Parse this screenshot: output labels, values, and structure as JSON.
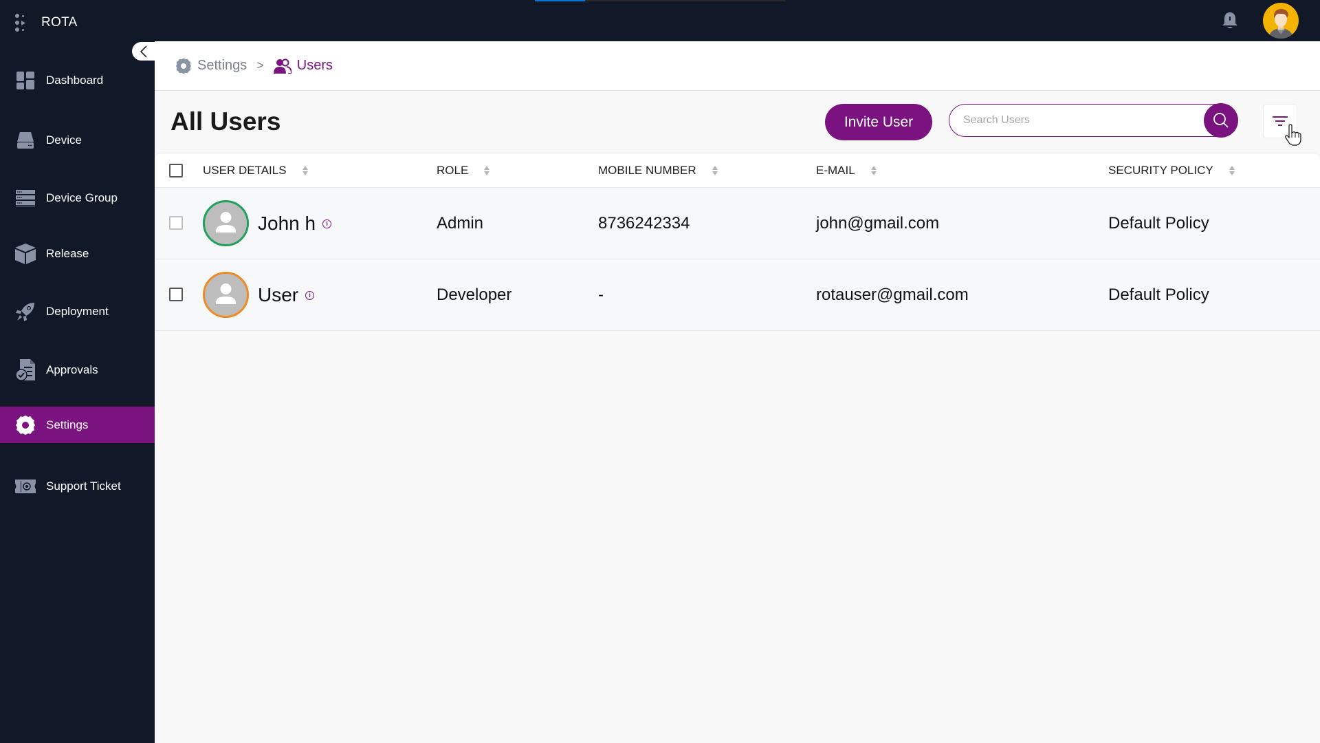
{
  "app": {
    "name": "ROTA",
    "loading_progress_percent": 20
  },
  "topbar": {
    "notification_icon": "bell-icon",
    "profile_icon": "user-avatar-icon"
  },
  "sidebar": {
    "collapse_icon": "chevron-left-icon",
    "items": [
      {
        "label": "Dashboard",
        "icon": "dashboard-icon",
        "active": false
      },
      {
        "label": "Device",
        "icon": "device-icon",
        "active": false
      },
      {
        "label": "Device Group",
        "icon": "server-icon",
        "active": false
      },
      {
        "label": "Release",
        "icon": "box-icon",
        "active": false
      },
      {
        "label": "Deployment",
        "icon": "rocket-icon",
        "active": false
      },
      {
        "label": "Approvals",
        "icon": "approval-document-icon",
        "active": false
      },
      {
        "label": "Settings",
        "icon": "gear-icon",
        "active": true
      },
      {
        "label": "Support Ticket",
        "icon": "ticket-icon",
        "active": false
      }
    ]
  },
  "breadcrumb": {
    "items": [
      {
        "label": "Settings",
        "icon": "gear-icon"
      },
      {
        "label": "Users",
        "icon": "users-icon"
      }
    ],
    "separator": ">"
  },
  "page": {
    "title": "All Users",
    "invite_button": "Invite User",
    "search": {
      "placeholder": "Search Users",
      "value": ""
    },
    "filter_icon": "filter-icon"
  },
  "table": {
    "columns": [
      "USER DETAILS",
      "ROLE",
      "MOBILE NUMBER",
      "E-MAIL",
      "SECURITY POLICY"
    ],
    "rows": [
      {
        "name": "John h",
        "role": "Admin",
        "mobile": "8736242334",
        "email": "john@gmail.com",
        "policy": "Default Policy",
        "avatar_ring": "#20a05a"
      },
      {
        "name": "User",
        "role": "Developer",
        "mobile": "-",
        "email": "rotauser@gmail.com",
        "policy": "Default Policy",
        "avatar_ring": "#f08a24"
      }
    ]
  },
  "colors": {
    "brand": "#7a127f",
    "sidebar_bg": "#111827",
    "active_nav": "#7a127f",
    "icon_gray": "#8a93a6"
  }
}
